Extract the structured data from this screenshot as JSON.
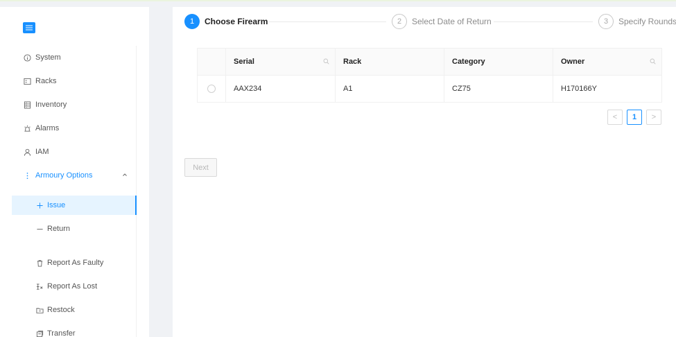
{
  "sidebar": {
    "items": [
      {
        "label": "System",
        "icon": "info-circle-icon"
      },
      {
        "label": "Racks",
        "icon": "rack-icon"
      },
      {
        "label": "Inventory",
        "icon": "inventory-icon"
      },
      {
        "label": "Alarms",
        "icon": "alarm-icon"
      },
      {
        "label": "IAM",
        "icon": "user-icon"
      },
      {
        "label": "Armoury Options",
        "icon": "more-vertical-icon",
        "expanded": true
      }
    ],
    "subitems": [
      {
        "label": "Issue",
        "icon": "plus-icon",
        "selected": true
      },
      {
        "label": "Return",
        "icon": "minus-icon"
      },
      {
        "label": "Report As Faulty",
        "icon": "trash-icon"
      },
      {
        "label": "Report As Lost",
        "icon": "lost-icon"
      },
      {
        "label": "Restock",
        "icon": "folder-icon"
      },
      {
        "label": "Transfer",
        "icon": "transfer-icon"
      }
    ]
  },
  "steps": [
    {
      "number": "1",
      "title": "Choose Firearm",
      "status": "active"
    },
    {
      "number": "2",
      "title": "Select Date of Return",
      "status": "wait"
    },
    {
      "number": "3",
      "title": "Specify Rounds",
      "status": "wait"
    }
  ],
  "table": {
    "columns": [
      "Serial",
      "Rack",
      "Category",
      "Owner"
    ],
    "rows": [
      {
        "serial": "AAX234",
        "rack": "A1",
        "category": "CZ75",
        "owner": "H170166Y"
      }
    ]
  },
  "pagination": {
    "prev": "<",
    "current": "1",
    "next": ">"
  },
  "actions": {
    "next_label": "Next"
  },
  "colors": {
    "primary": "#1890ff",
    "background": "#f0f2f5"
  }
}
